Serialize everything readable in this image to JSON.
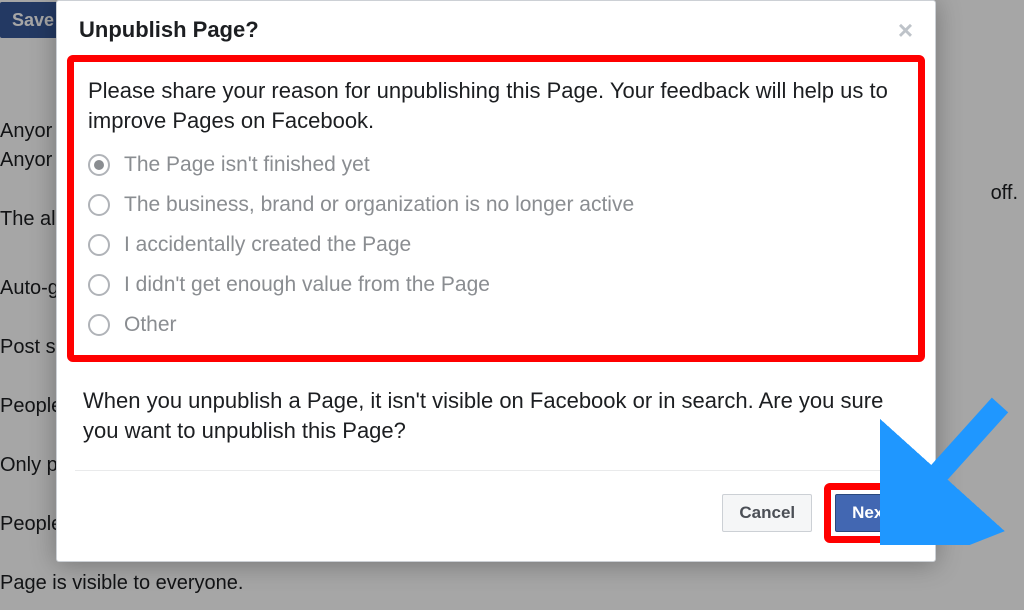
{
  "background": {
    "save_label": "Save",
    "lines": [
      "Anyor",
      "Anyor",
      "The al",
      "Auto-g",
      "Post s",
      "People",
      "Only p",
      "People",
      "Page is visible to everyone."
    ],
    "right_snippet": "off."
  },
  "modal": {
    "title": "Unpublish Page?",
    "instruction": "Please share your reason for unpublishing this Page. Your feedback will help us to improve Pages on Facebook.",
    "options": [
      {
        "label": "The Page isn't finished yet",
        "selected": true
      },
      {
        "label": "The business, brand or organization is no longer active",
        "selected": false
      },
      {
        "label": "I accidentally created the Page",
        "selected": false
      },
      {
        "label": "I didn't get enough value from the Page",
        "selected": false
      },
      {
        "label": "Other",
        "selected": false
      }
    ],
    "confirm": "When you unpublish a Page, it isn't visible on Facebook or in search. Are you sure you want to unpublish this Page?",
    "cancel_label": "Cancel",
    "next_label": "Next"
  },
  "annotations": {
    "highlight_color": "#ff0000",
    "arrow_color": "#1f97ff"
  }
}
